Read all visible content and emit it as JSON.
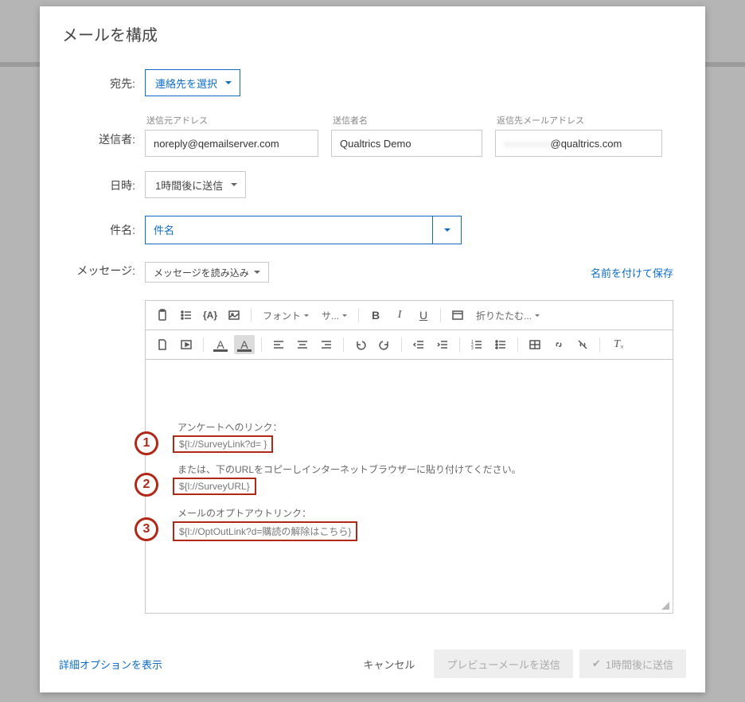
{
  "modal": {
    "title": "メールを構成"
  },
  "to": {
    "label": "宛先:",
    "select_contacts": "連絡先を選択"
  },
  "from": {
    "label": "送信者:",
    "from_address_label": "送信元アドレス",
    "from_address_value": "noreply@qemailserver.com",
    "from_name_label": "送信者名",
    "from_name_value": "Qualtrics Demo",
    "reply_to_label": "返信先メールアドレス",
    "reply_to_value": "@qualtrics.com"
  },
  "when": {
    "label": "日時:",
    "value": "1時間後に送信"
  },
  "subject": {
    "label": "件名:",
    "placeholder": "件名"
  },
  "message": {
    "label": "メッセージ:",
    "load": "メッセージを読み込み",
    "save_as": "名前を付けて保存"
  },
  "toolbar": {
    "font": "フォント",
    "size": "サ...",
    "collapse": "折りたたむ..."
  },
  "body": {
    "link_heading": "アンケートへのリンク：",
    "survey_link": "${l://SurveyLink?d=                             }",
    "or_paste": "または、下のURLをコピーしインターネットブラウザーに貼り付けてください。",
    "survey_url": "${l://SurveyURL}",
    "optout_heading": "メールのオプトアウトリンク：",
    "optout_link": "${l://OptOutLink?d=購読の解除はこちら}"
  },
  "annot": {
    "n1": "1",
    "n2": "2",
    "n3": "3"
  },
  "footer": {
    "advanced": "詳細オプションを表示",
    "cancel": "キャンセル",
    "preview": "プレビューメールを送信",
    "send": "1時間後に送信"
  }
}
